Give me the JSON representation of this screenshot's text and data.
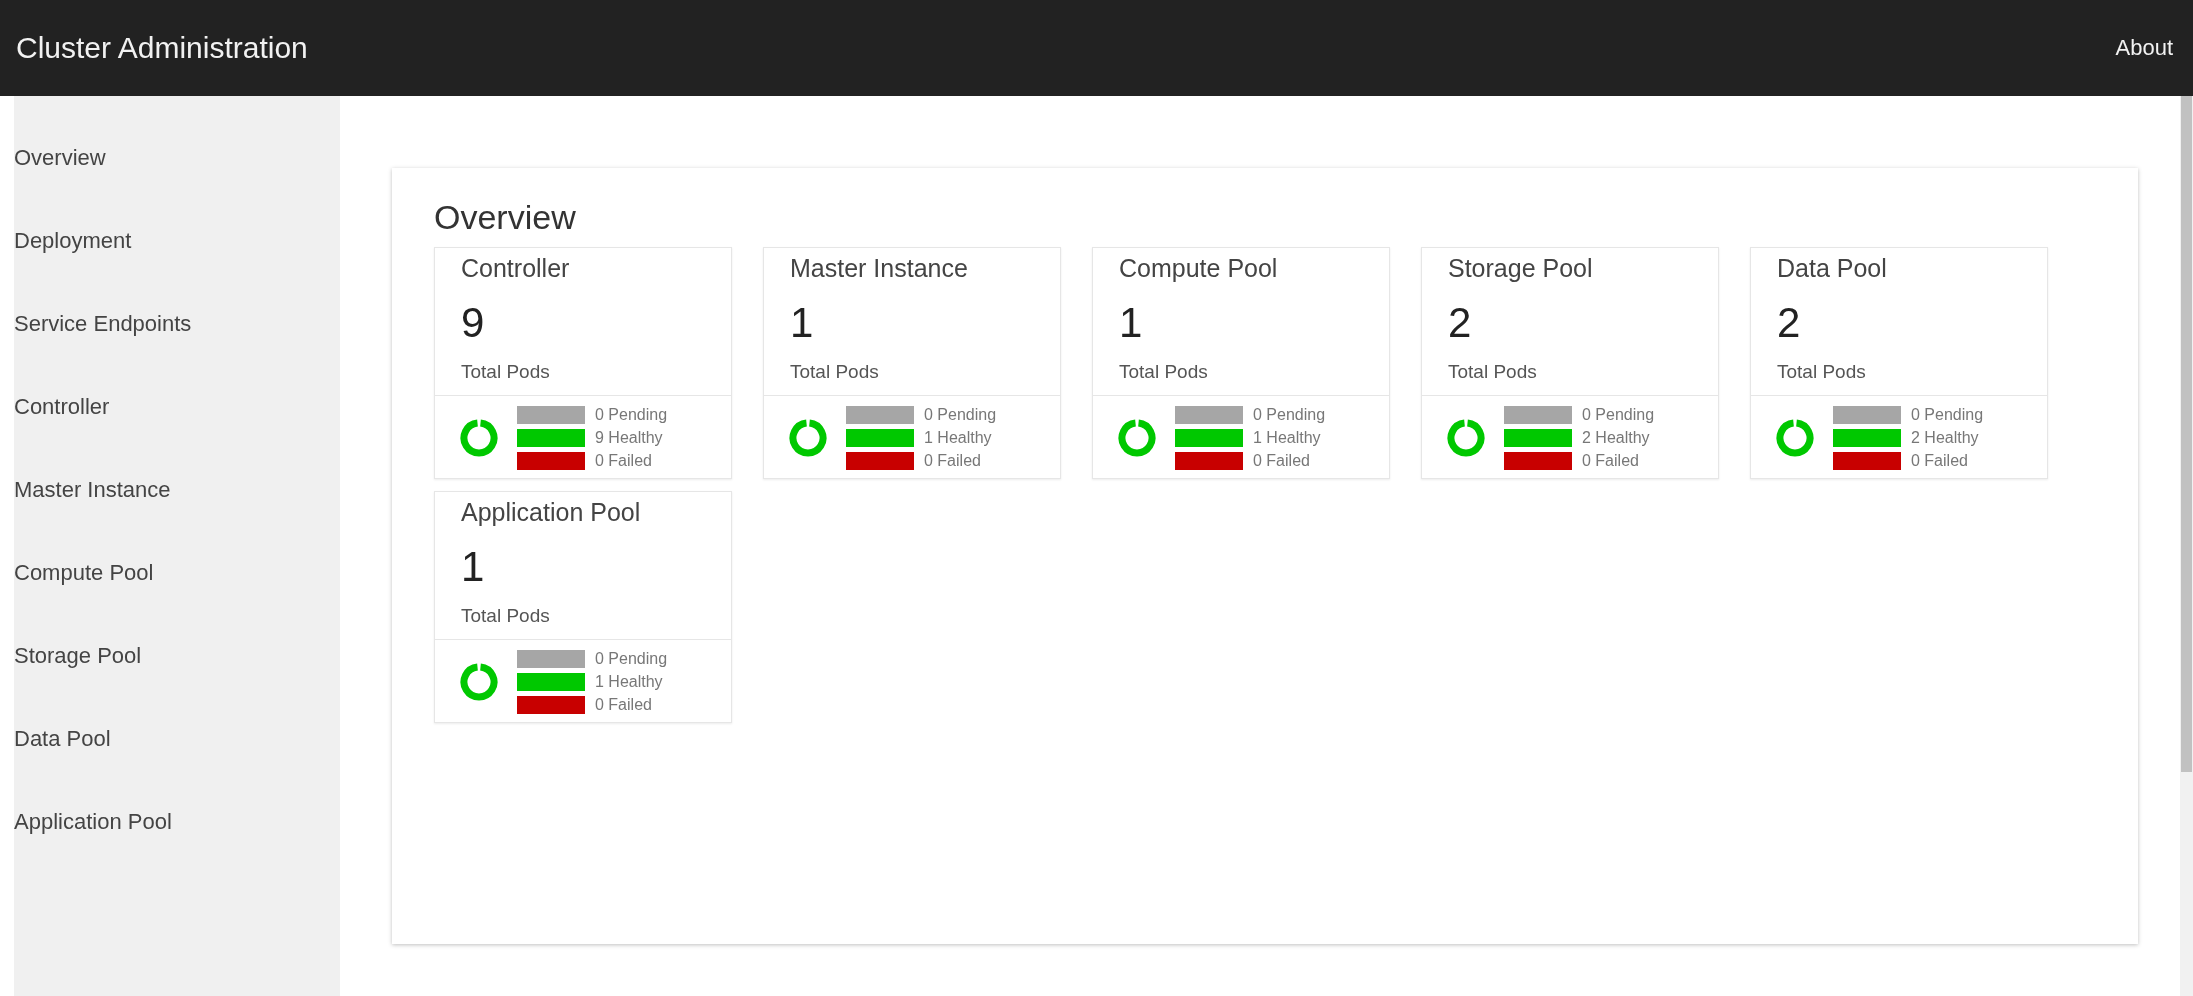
{
  "header": {
    "title": "Cluster Administration",
    "about": "About"
  },
  "sidebar": {
    "items": [
      {
        "label": "Overview"
      },
      {
        "label": "Deployment"
      },
      {
        "label": "Service Endpoints"
      },
      {
        "label": "Controller"
      },
      {
        "label": "Master Instance"
      },
      {
        "label": "Compute Pool"
      },
      {
        "label": "Storage Pool"
      },
      {
        "label": "Data Pool"
      },
      {
        "label": "Application Pool"
      }
    ]
  },
  "panel": {
    "title": "Overview",
    "cards": [
      {
        "title": "Controller",
        "count": "9",
        "caption": "Total Pods",
        "statuses": [
          {
            "label": "0 Pending",
            "color": "#a6a6a6"
          },
          {
            "label": "9 Healthy",
            "color": "#00c800"
          },
          {
            "label": "0 Failed",
            "color": "#c80000"
          }
        ]
      },
      {
        "title": "Master Instance",
        "count": "1",
        "caption": "Total Pods",
        "statuses": [
          {
            "label": "0 Pending",
            "color": "#a6a6a6"
          },
          {
            "label": "1 Healthy",
            "color": "#00c800"
          },
          {
            "label": "0 Failed",
            "color": "#c80000"
          }
        ]
      },
      {
        "title": "Compute Pool",
        "count": "1",
        "caption": "Total Pods",
        "statuses": [
          {
            "label": "0 Pending",
            "color": "#a6a6a6"
          },
          {
            "label": "1 Healthy",
            "color": "#00c800"
          },
          {
            "label": "0 Failed",
            "color": "#c80000"
          }
        ]
      },
      {
        "title": "Storage Pool",
        "count": "2",
        "caption": "Total Pods",
        "statuses": [
          {
            "label": "0 Pending",
            "color": "#a6a6a6"
          },
          {
            "label": "2 Healthy",
            "color": "#00c800"
          },
          {
            "label": "0 Failed",
            "color": "#c80000"
          }
        ]
      },
      {
        "title": "Data Pool",
        "count": "2",
        "caption": "Total Pods",
        "statuses": [
          {
            "label": "0 Pending",
            "color": "#a6a6a6"
          },
          {
            "label": "2 Healthy",
            "color": "#00c800"
          },
          {
            "label": "0 Failed",
            "color": "#c80000"
          }
        ]
      },
      {
        "title": "Application Pool",
        "count": "1",
        "caption": "Total Pods",
        "statuses": [
          {
            "label": "0 Pending",
            "color": "#a6a6a6"
          },
          {
            "label": "1 Healthy",
            "color": "#00c800"
          },
          {
            "label": "0 Failed",
            "color": "#c80000"
          }
        ]
      }
    ]
  }
}
